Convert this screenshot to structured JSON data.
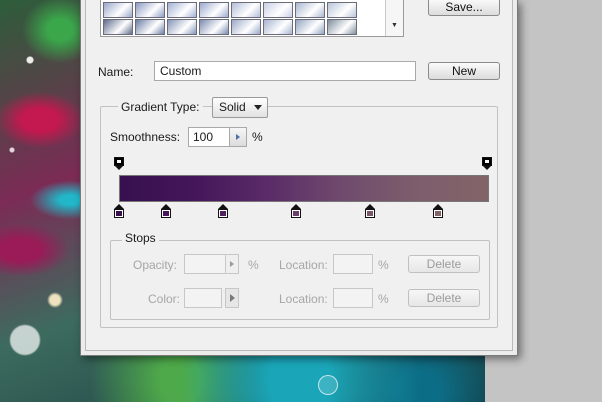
{
  "dialog": {
    "save_label": "Save...",
    "new_label": "New",
    "name_label": "Name:",
    "name_value": "Custom",
    "gradient_type_label": "Gradient Type:",
    "gradient_type_value": "Solid",
    "smoothness_label": "Smoothness:",
    "smoothness_value": "100",
    "smoothness_unit": "%",
    "presets_row1": [
      "#9aa7c9",
      "#8c9bc3",
      "#a3b1d3",
      "#9ea9cd",
      "#b3bdd9",
      "#c9d0e6",
      "#aab7d1",
      "#b9c5da"
    ],
    "presets_row2": [
      "#5e6b8c",
      "#6d7ea6",
      "#8596b8",
      "#7b8bb0",
      "#9aa8c8",
      "#a6b4d1",
      "#93a4c0",
      "#7f8f9d"
    ],
    "gradient_colors": [
      "#37104f",
      "#441659",
      "#5a2b68",
      "#6f4a6d",
      "#7d5d6c",
      "#826468"
    ],
    "color_stop_colors": [
      "#3a114f",
      "#46185b",
      "#50215e",
      "#6a3f6a",
      "#7a5868",
      "#826468"
    ],
    "stops": {
      "legend": "Stops",
      "opacity_label": "Opacity:",
      "opacity_unit": "%",
      "location_label_1": "Location:",
      "location_unit_1": "%",
      "delete_label_1": "Delete",
      "color_label": "Color:",
      "location_label_2": "Location:",
      "location_unit_2": "%",
      "delete_label_2": "Delete"
    }
  }
}
